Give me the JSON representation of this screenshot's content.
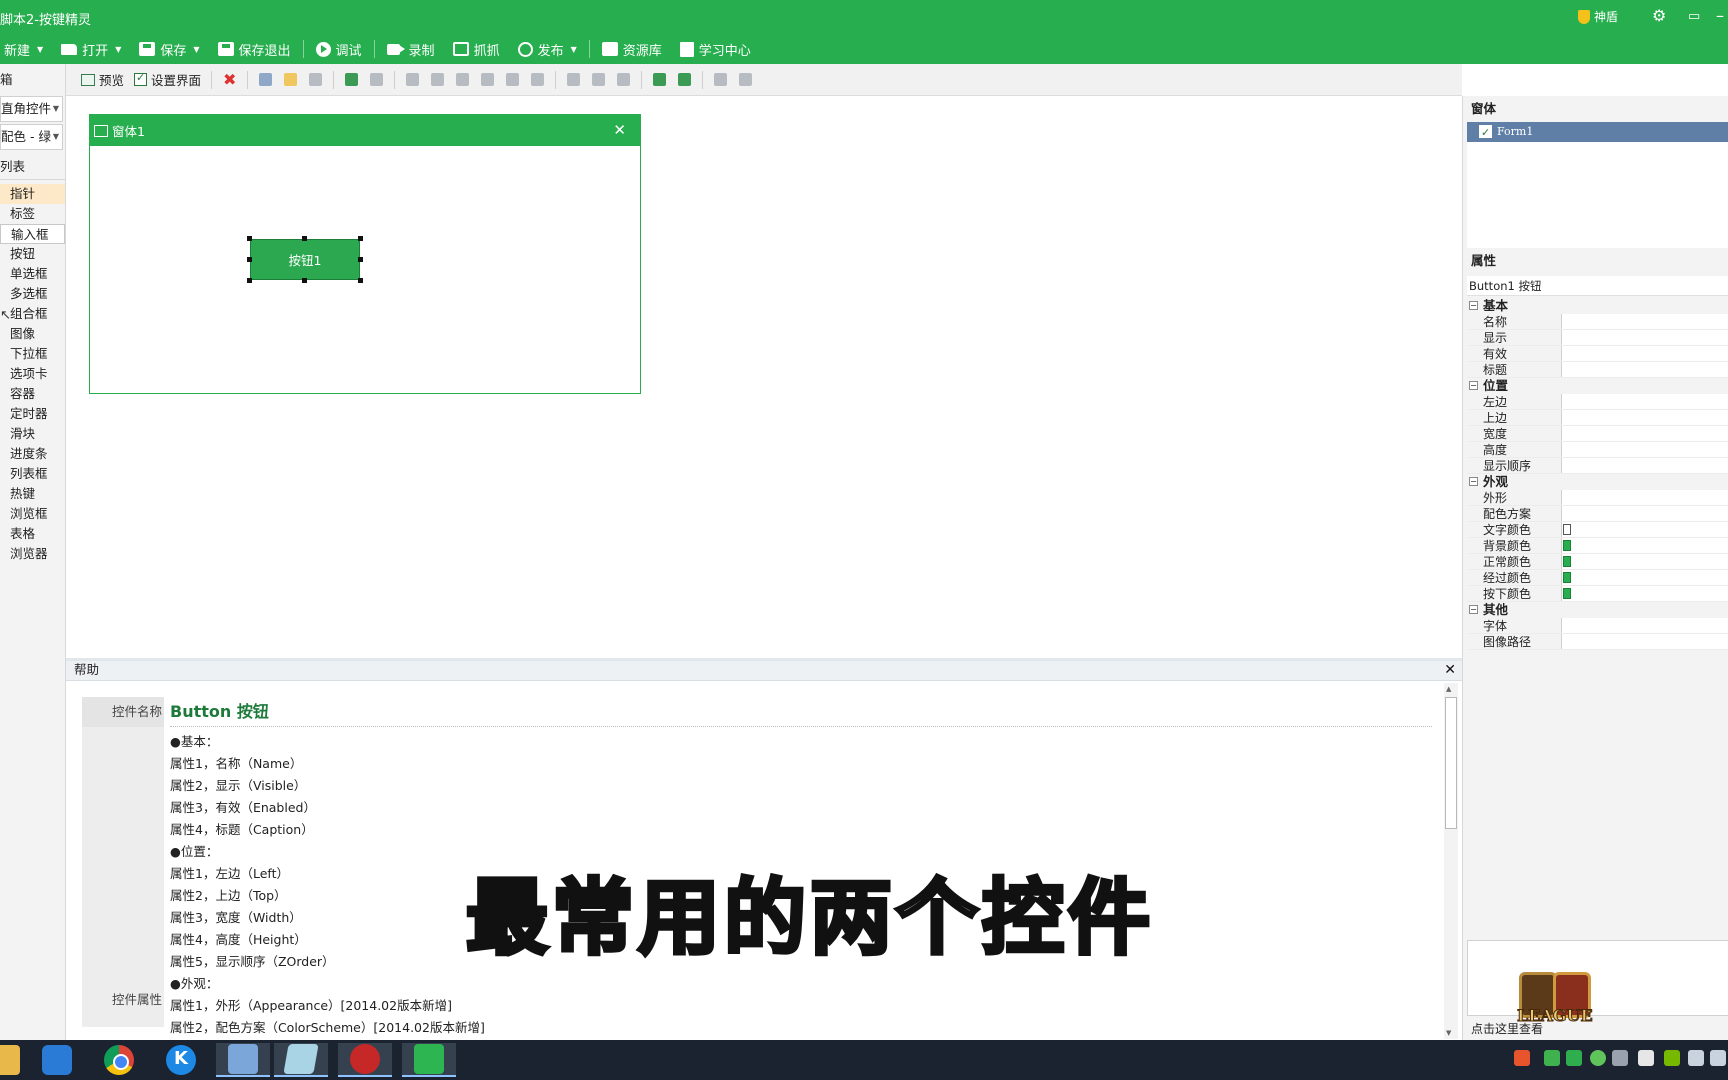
{
  "window": {
    "title": "脚本2-按键精灵",
    "shield_label": "神盾"
  },
  "toolbar": {
    "new": "新建",
    "open": "打开",
    "save": "保存",
    "save_exit": "保存退出",
    "debug": "调试",
    "record": "录制",
    "capture": "抓抓",
    "publish": "发布",
    "resources": "资源库",
    "learning": "学习中心"
  },
  "subtoolbar": {
    "preview": "预览",
    "settings": "设置界面"
  },
  "toolbox": {
    "header": "箱",
    "style_select": "直角控件",
    "color_select": "配色 - 绿",
    "list_header": "列表",
    "items": [
      "指针",
      "标签",
      "输入框",
      "按钮",
      "单选框",
      "多选框",
      "组合框",
      "图像",
      "下拉框",
      "选项卡",
      "容器",
      "定时器",
      "滑块",
      "进度条",
      "列表框",
      "热键",
      "浏览框",
      "表格",
      "浏览器"
    ]
  },
  "designer": {
    "form_title": "窗体1",
    "button_caption": "按钮1"
  },
  "help": {
    "header": "帮助",
    "control_name_label": "控件名称",
    "control_props_label": "控件属性",
    "title": "Button 按钮",
    "lines": [
      "●基本：",
      "属性1，名称（Name）",
      "属性2，显示（Visible）",
      "属性3，有效（Enabled）",
      "属性4，标题（Caption）",
      "●位置：",
      "属性1，左边（Left）",
      "属性2，上边（Top）",
      "属性3，宽度（Width）",
      "属性4，高度（Height）",
      "属性5，显示顺序（ZOrder）",
      "●外观：",
      "属性1，外形（Appearance）[2014.02版本新增]",
      "属性2，配色方案（ColorScheme）[2014.02版本新增]"
    ]
  },
  "subtitle": "最常用的两个控件",
  "right_panel": {
    "forms_title": "窗体",
    "form_item": "Form1",
    "props_title": "属性",
    "object_line": "Button1 按钮",
    "groups": [
      {
        "name": "基本",
        "rows": [
          "名称",
          "显示",
          "有效",
          "标题"
        ]
      },
      {
        "name": "位置",
        "rows": [
          "左边",
          "上边",
          "宽度",
          "高度",
          "显示顺序"
        ]
      },
      {
        "name": "外观",
        "rows": [
          "外形",
          "配色方案",
          "文字颜色",
          "背景颜色",
          "正常颜色",
          "经过颜色",
          "按下颜色"
        ]
      },
      {
        "name": "其他",
        "rows": [
          "字体",
          "图像路径"
        ]
      }
    ],
    "hint": "点击这里查看",
    "badge_text": "LEAGUE"
  },
  "colors": {
    "accent": "#27ae4f",
    "selected_item": "#fde9c8",
    "form_selected": "#5f7fa6"
  }
}
